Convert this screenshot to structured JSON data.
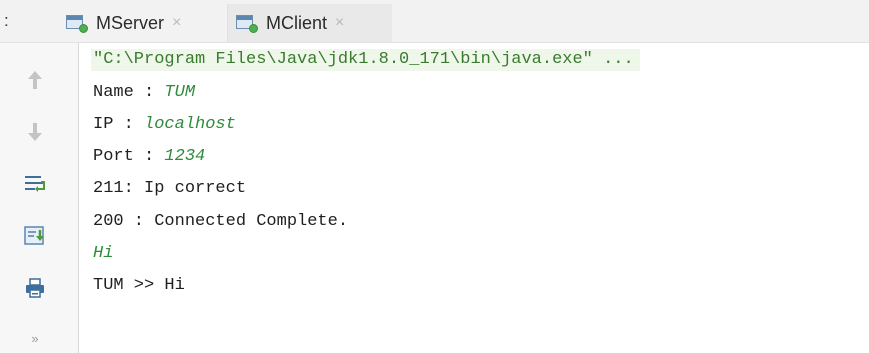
{
  "tabs": {
    "prefix": ":",
    "items": [
      {
        "label": "MServer",
        "close": "×"
      },
      {
        "label": "MClient",
        "close": "×"
      }
    ]
  },
  "toolbar": {
    "items": [
      "up-arrow-icon",
      "down-arrow-icon",
      "soft-wrap-icon",
      "scroll-to-end-icon",
      "print-icon",
      "more-icon"
    ],
    "more_label": "»"
  },
  "console": {
    "command": "\"C:\\Program Files\\Java\\jdk1.8.0_171\\bin\\java.exe\" ...",
    "name_prompt": "Name : ",
    "name_value": "TUM",
    "ip_prompt": "IP : ",
    "ip_value": "localhost",
    "port_prompt": "Port : ",
    "port_value": "1234",
    "line_ip_correct": "211: Ip correct",
    "line_connected": "200 : Connected Complete.",
    "input_hi": "Hi",
    "line_echo": "TUM >> Hi"
  },
  "colors": {
    "input_text": "#2e8b3a",
    "command_text": "#3a7b2f",
    "command_bg": "#eef7e9"
  }
}
